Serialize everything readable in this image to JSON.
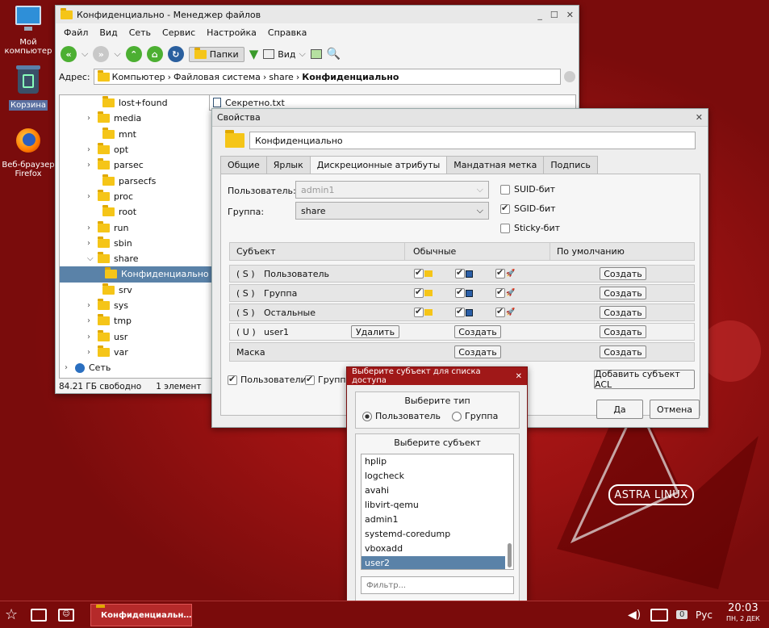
{
  "desktop": {
    "icons": [
      {
        "label": "Мой компьютер",
        "icon": "computer-icon"
      },
      {
        "label": "Корзина",
        "icon": "trash-icon"
      },
      {
        "label": "Веб-браузер Firefox",
        "icon": "firefox-icon"
      }
    ],
    "brand": "ASTRA LINUX"
  },
  "file_manager": {
    "title": "Конфиденциально - Менеджер файлов",
    "menu": [
      "Файл",
      "Вид",
      "Сеть",
      "Сервис",
      "Настройка",
      "Справка"
    ],
    "toolbar": {
      "folders_label": "Папки",
      "view_label": "Вид"
    },
    "address_label": "Адрес:",
    "breadcrumb": [
      "Компьютер",
      "Файловая система",
      "share",
      "Конфиденциально"
    ],
    "tree": [
      "lost+found",
      "media",
      "mnt",
      "opt",
      "parsec",
      "parsecfs",
      "proc",
      "root",
      "run",
      "sbin",
      "share",
      "Конфиденциально",
      "srv",
      "sys",
      "tmp",
      "usr",
      "var",
      "Сеть"
    ],
    "file": "Секретно.txt",
    "status": {
      "free": "84.21 ГБ свободно",
      "count": "1 элемент"
    }
  },
  "properties": {
    "title": "Свойства",
    "name": "Конфиденциально",
    "tabs": [
      "Общие",
      "Ярлык",
      "Дискреционные атрибуты",
      "Мандатная метка",
      "Подпись"
    ],
    "active_tab": "Дискреционные атрибуты",
    "user_label": "Пользователь:",
    "user_value": "admin1",
    "group_label": "Группа:",
    "group_value": "share",
    "suid": "SUID-бит",
    "sgid": "SGID-бит",
    "sticky": "Sticky-бит",
    "col_subject": "Субъект",
    "col_regular": "Обычные",
    "col_default": "По умолчанию",
    "rows": [
      {
        "tag": "( S )",
        "name": "Пользователь"
      },
      {
        "tag": "( S )",
        "name": "Группа"
      },
      {
        "tag": "( S )",
        "name": "Остальные"
      },
      {
        "tag": "( U )",
        "name": "user1"
      }
    ],
    "create": "Создать",
    "delete": "Удалить",
    "mask": "Маска",
    "show_users": "Пользователи",
    "show_groups": "Группы",
    "add_acl": "Добавить субъект ACL",
    "ok": "Да",
    "cancel": "Отмена"
  },
  "chooser": {
    "title": "Выберите субъект для списка доступа",
    "type_title": "Выберите тип",
    "radio_user": "Пользователь",
    "radio_group": "Группа",
    "subject_title": "Выберите субъект",
    "items": [
      "hplip",
      "logcheck",
      "avahi",
      "libvirt-qemu",
      "admin1",
      "systemd-coredump",
      "vboxadd",
      "user2"
    ],
    "selected": "user2",
    "filter_placeholder": "Фильтр..."
  },
  "taskbar": {
    "task": "Конфиденциальн…",
    "lang": "Рус",
    "time": "20:03",
    "date": "ПН, 2 ДЕК",
    "badge": "0"
  }
}
